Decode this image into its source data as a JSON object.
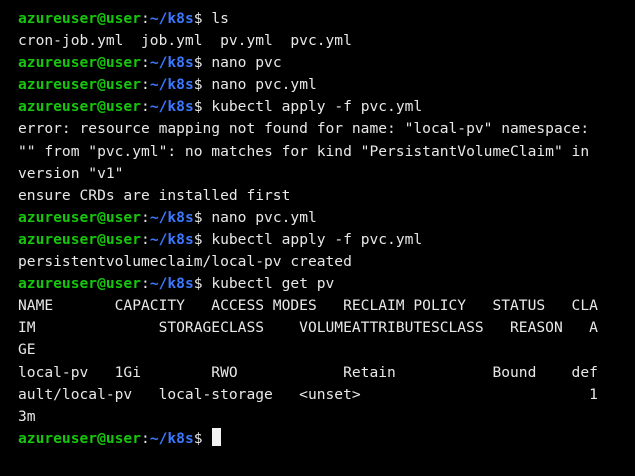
{
  "prompt": {
    "user": "azureuser@user",
    "colon": ":",
    "path": "~/k8s",
    "symbol": "$ "
  },
  "lines": [
    {
      "type": "cmd",
      "text": "ls"
    },
    {
      "type": "out",
      "text": "cron-job.yml  job.yml  pv.yml  pvc.yml"
    },
    {
      "type": "cmd",
      "text": "nano pvc"
    },
    {
      "type": "cmd",
      "text": "nano pvc.yml"
    },
    {
      "type": "cmd",
      "text": "kubectl apply -f pvc.yml"
    },
    {
      "type": "out",
      "text": "error: resource mapping not found for name: \"local-pv\" namespace:"
    },
    {
      "type": "out",
      "text": "\"\" from \"pvc.yml\": no matches for kind \"PersistantVolumeClaim\" in"
    },
    {
      "type": "out",
      "text": "version \"v1\""
    },
    {
      "type": "out",
      "text": "ensure CRDs are installed first"
    },
    {
      "type": "cmd",
      "text": "nano pvc.yml"
    },
    {
      "type": "cmd",
      "text": "kubectl apply -f pvc.yml"
    },
    {
      "type": "out",
      "text": "persistentvolumeclaim/local-pv created"
    },
    {
      "type": "cmd",
      "text": "kubectl get pv"
    },
    {
      "type": "out",
      "text": "NAME       CAPACITY   ACCESS MODES   RECLAIM POLICY   STATUS   CLA"
    },
    {
      "type": "out",
      "text": "IM              STORAGECLASS    VOLUMEATTRIBUTESCLASS   REASON   A"
    },
    {
      "type": "out",
      "text": "GE"
    },
    {
      "type": "out",
      "text": "local-pv   1Gi        RWO            Retain           Bound    def"
    },
    {
      "type": "out",
      "text": "ault/local-pv   local-storage   <unset>                          1"
    },
    {
      "type": "out",
      "text": "3m"
    },
    {
      "type": "cmd",
      "text": ""
    }
  ],
  "colors": {
    "background": "#000000",
    "text": "#e8e8e8",
    "user": "#16c60c",
    "path": "#3b78ff",
    "cursor": "#f2f2f2"
  }
}
